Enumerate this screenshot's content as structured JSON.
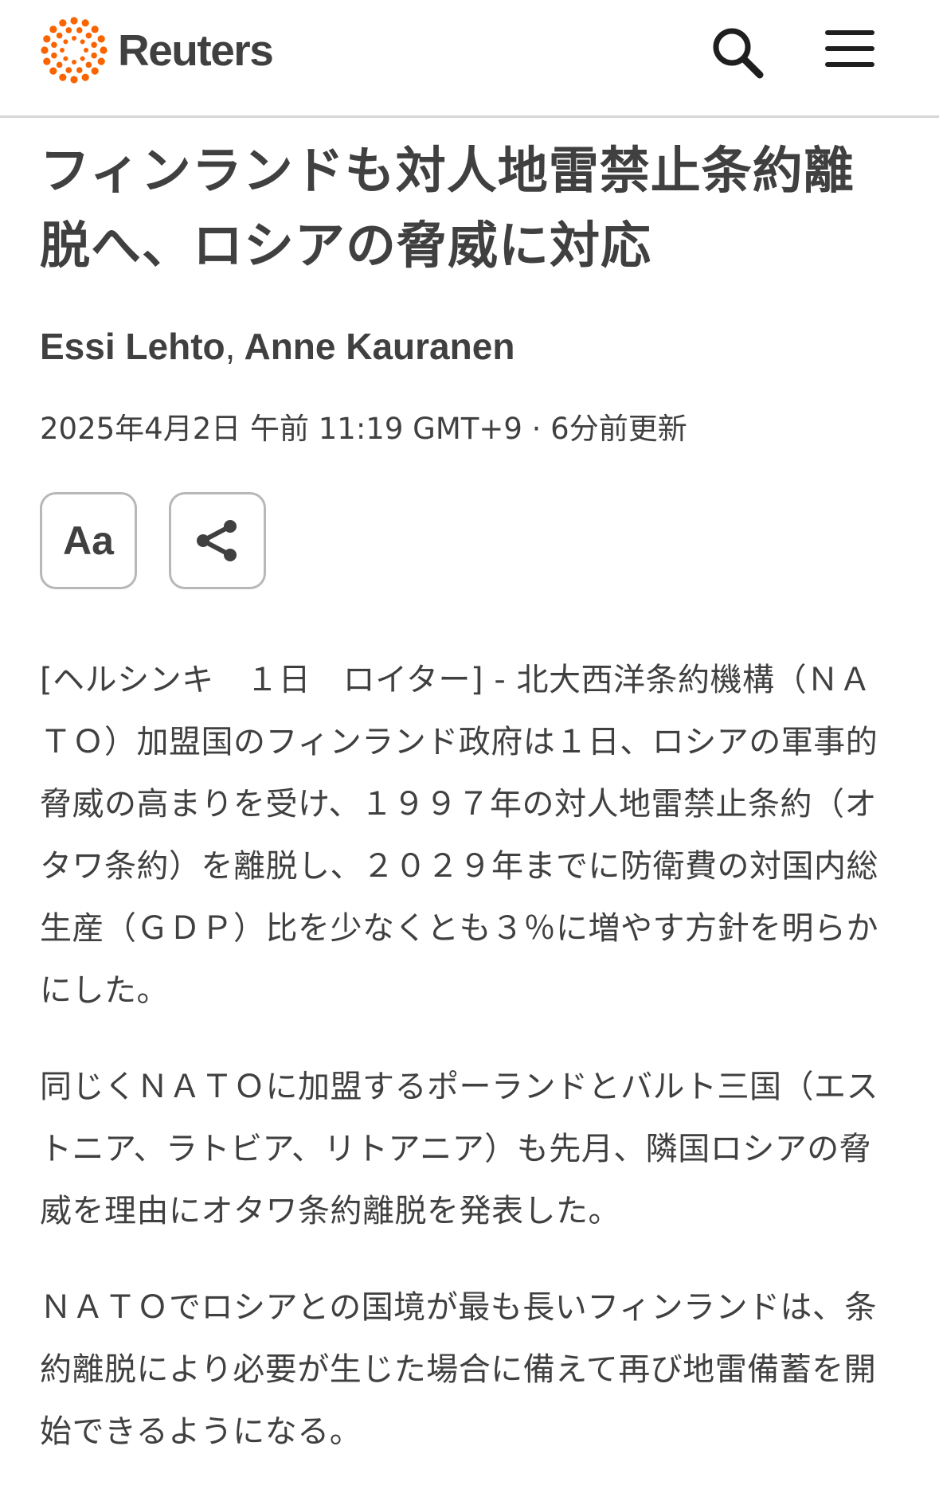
{
  "header": {
    "brand": "Reuters",
    "brand_color": "#fa6400",
    "search_icon": "search-icon",
    "menu_icon": "hamburger-menu-icon"
  },
  "article": {
    "headline": "フィンランドも対人地雷禁止条約離脱へ、ロシアの脅威に対応",
    "authors": [
      "Essi Lehto",
      "Anne Kauranen"
    ],
    "author_separator": ",",
    "dateline": "2025年4月2日 午前 11:19 GMT+9 · 6分前更新",
    "tools": {
      "text_size_label": "Aa",
      "share_icon": "share-icon"
    },
    "paragraphs": [
      "[ヘルシンキ　１日　ロイター] - 北大西洋条約機構（ＮＡＴＯ）加盟国のフィンランド政府は１日、ロシアの軍事的脅威の高まりを受け、１９９７年の対人地雷禁止条約（オタワ条約）を離脱し、２０２９年までに防衛費の対国内総生産（ＧＤＰ）比を少なくとも３％に増やす方針を明らかにした。",
      "同じくＮＡＴＯに加盟するポーランドとバルト三国（エストニア、ラトビア、リトアニア）も先月、隣国ロシアの脅威を理由にオタワ条約離脱を発表した。",
      "ＮＡＴＯでロシアとの国境が最も長いフィンランドは、条約離脱により必要が生じた場合に備えて再び地雷備蓄を開始できるようになる。"
    ]
  }
}
